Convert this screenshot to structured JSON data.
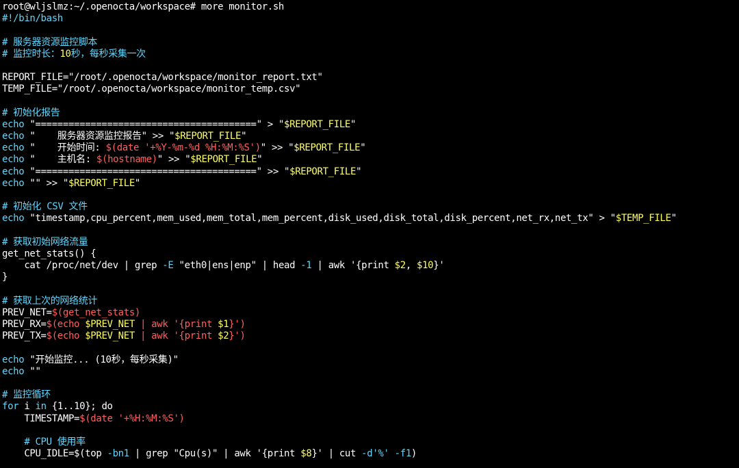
{
  "colors": {
    "background": "#000000",
    "default": "#ffffff",
    "comment": "#5fd7ff",
    "keyword": "#5fd7ff",
    "number": "#ffff5f",
    "variable": "#ffff5f",
    "subst": "#ff5f5f",
    "string": "#ffffff"
  },
  "lines": [
    [
      {
        "t": "root@wljslmz:~/.openocta/workspace# more monitor.sh",
        "c": "default"
      }
    ],
    [
      {
        "t": "#!/bin/bash",
        "c": "comment"
      }
    ],
    [],
    [
      {
        "t": "# 服务器资源监控脚本",
        "c": "comment"
      }
    ],
    [
      {
        "t": "# 监控时长：",
        "c": "comment"
      },
      {
        "t": "10",
        "c": "number"
      },
      {
        "t": "秒，每秒采集一次",
        "c": "comment"
      }
    ],
    [],
    [
      {
        "t": "REPORT_FILE=\"/root/.openocta/workspace/monitor_report.txt\"",
        "c": "default"
      }
    ],
    [
      {
        "t": "TEMP_FILE=\"/root/.openocta/workspace/monitor_temp.csv\"",
        "c": "default"
      }
    ],
    [],
    [
      {
        "t": "# 初始化报告",
        "c": "comment"
      }
    ],
    [
      {
        "t": "echo",
        "c": "keyword"
      },
      {
        "t": " \"========================================\" > \"",
        "c": "string"
      },
      {
        "t": "$REPORT_FILE",
        "c": "variable"
      },
      {
        "t": "\"",
        "c": "string"
      }
    ],
    [
      {
        "t": "echo",
        "c": "keyword"
      },
      {
        "t": " \"    服务器资源监控报告\" >> \"",
        "c": "string"
      },
      {
        "t": "$REPORT_FILE",
        "c": "variable"
      },
      {
        "t": "\"",
        "c": "string"
      }
    ],
    [
      {
        "t": "echo",
        "c": "keyword"
      },
      {
        "t": " \"    开始时间: ",
        "c": "string"
      },
      {
        "t": "$(date '+%Y-%m-%d %H:%M:%S')",
        "c": "subst"
      },
      {
        "t": "\" >> \"",
        "c": "string"
      },
      {
        "t": "$REPORT_FILE",
        "c": "variable"
      },
      {
        "t": "\"",
        "c": "string"
      }
    ],
    [
      {
        "t": "echo",
        "c": "keyword"
      },
      {
        "t": " \"    主机名: ",
        "c": "string"
      },
      {
        "t": "$(hostname)",
        "c": "subst"
      },
      {
        "t": "\" >> \"",
        "c": "string"
      },
      {
        "t": "$REPORT_FILE",
        "c": "variable"
      },
      {
        "t": "\"",
        "c": "string"
      }
    ],
    [
      {
        "t": "echo",
        "c": "keyword"
      },
      {
        "t": " \"========================================\" >> \"",
        "c": "string"
      },
      {
        "t": "$REPORT_FILE",
        "c": "variable"
      },
      {
        "t": "\"",
        "c": "string"
      }
    ],
    [
      {
        "t": "echo",
        "c": "keyword"
      },
      {
        "t": " \"\" >> \"",
        "c": "string"
      },
      {
        "t": "$REPORT_FILE",
        "c": "variable"
      },
      {
        "t": "\"",
        "c": "string"
      }
    ],
    [],
    [
      {
        "t": "# 初始化 ",
        "c": "comment"
      },
      {
        "t": "CSV",
        "c": "keyword"
      },
      {
        "t": " 文件",
        "c": "comment"
      }
    ],
    [
      {
        "t": "echo",
        "c": "keyword"
      },
      {
        "t": " \"timestamp,cpu_percent,mem_used,mem_total,mem_percent,disk_used,disk_total,disk_percent,net_rx,net_tx\" > \"",
        "c": "string"
      },
      {
        "t": "$TEMP_FILE",
        "c": "variable"
      },
      {
        "t": "\"",
        "c": "string"
      }
    ],
    [],
    [
      {
        "t": "# 获取初始网络流量",
        "c": "comment"
      }
    ],
    [
      {
        "t": "get_net_stats() {",
        "c": "default"
      }
    ],
    [
      {
        "t": "    cat /proc/net/dev | grep ",
        "c": "default"
      },
      {
        "t": "-E",
        "c": "keyword"
      },
      {
        "t": " \"eth0|ens|enp\" | head ",
        "c": "default"
      },
      {
        "t": "-1",
        "c": "keyword"
      },
      {
        "t": " | awk '{print ",
        "c": "default"
      },
      {
        "t": "$2",
        "c": "variable"
      },
      {
        "t": ", ",
        "c": "default"
      },
      {
        "t": "$10",
        "c": "variable"
      },
      {
        "t": "}'",
        "c": "default"
      }
    ],
    [
      {
        "t": "}",
        "c": "default"
      }
    ],
    [],
    [
      {
        "t": "# 获取上次的网络统计",
        "c": "comment"
      }
    ],
    [
      {
        "t": "PREV_NET=",
        "c": "default"
      },
      {
        "t": "$(get_net_stats)",
        "c": "subst"
      }
    ],
    [
      {
        "t": "PREV_RX=",
        "c": "default"
      },
      {
        "t": "$(echo ",
        "c": "subst"
      },
      {
        "t": "$PREV_NET",
        "c": "variable"
      },
      {
        "t": " | awk '{print ",
        "c": "subst"
      },
      {
        "t": "$1",
        "c": "variable"
      },
      {
        "t": "}')",
        "c": "subst"
      }
    ],
    [
      {
        "t": "PREV_TX=",
        "c": "default"
      },
      {
        "t": "$(echo ",
        "c": "subst"
      },
      {
        "t": "$PREV_NET",
        "c": "variable"
      },
      {
        "t": " | awk '{print ",
        "c": "subst"
      },
      {
        "t": "$2",
        "c": "variable"
      },
      {
        "t": "}')",
        "c": "subst"
      }
    ],
    [],
    [
      {
        "t": "echo",
        "c": "keyword"
      },
      {
        "t": " \"开始监控... (10秒，每秒采集)\"",
        "c": "string"
      }
    ],
    [
      {
        "t": "echo",
        "c": "keyword"
      },
      {
        "t": " \"\"",
        "c": "string"
      }
    ],
    [],
    [
      {
        "t": "# 监控循环",
        "c": "comment"
      }
    ],
    [
      {
        "t": "for",
        "c": "keyword"
      },
      {
        "t": " i ",
        "c": "default"
      },
      {
        "t": "in",
        "c": "keyword"
      },
      {
        "t": " {1..10}; do",
        "c": "default"
      }
    ],
    [
      {
        "t": "    TIMESTAMP=",
        "c": "default"
      },
      {
        "t": "$(date '+%H:%M:%S')",
        "c": "subst"
      }
    ],
    [],
    [
      {
        "t": "    # CPU 使用率",
        "c": "comment"
      }
    ],
    [
      {
        "t": "    CPU_IDLE=$(top ",
        "c": "default"
      },
      {
        "t": "-bn1",
        "c": "keyword"
      },
      {
        "t": " | grep \"Cpu(s)\" | awk '{print ",
        "c": "default"
      },
      {
        "t": "$8",
        "c": "variable"
      },
      {
        "t": "}' | cut ",
        "c": "default"
      },
      {
        "t": "-d'%'",
        "c": "keyword"
      },
      {
        "t": " ",
        "c": "default"
      },
      {
        "t": "-f1",
        "c": "keyword"
      },
      {
        "t": ")",
        "c": "default"
      }
    ]
  ]
}
